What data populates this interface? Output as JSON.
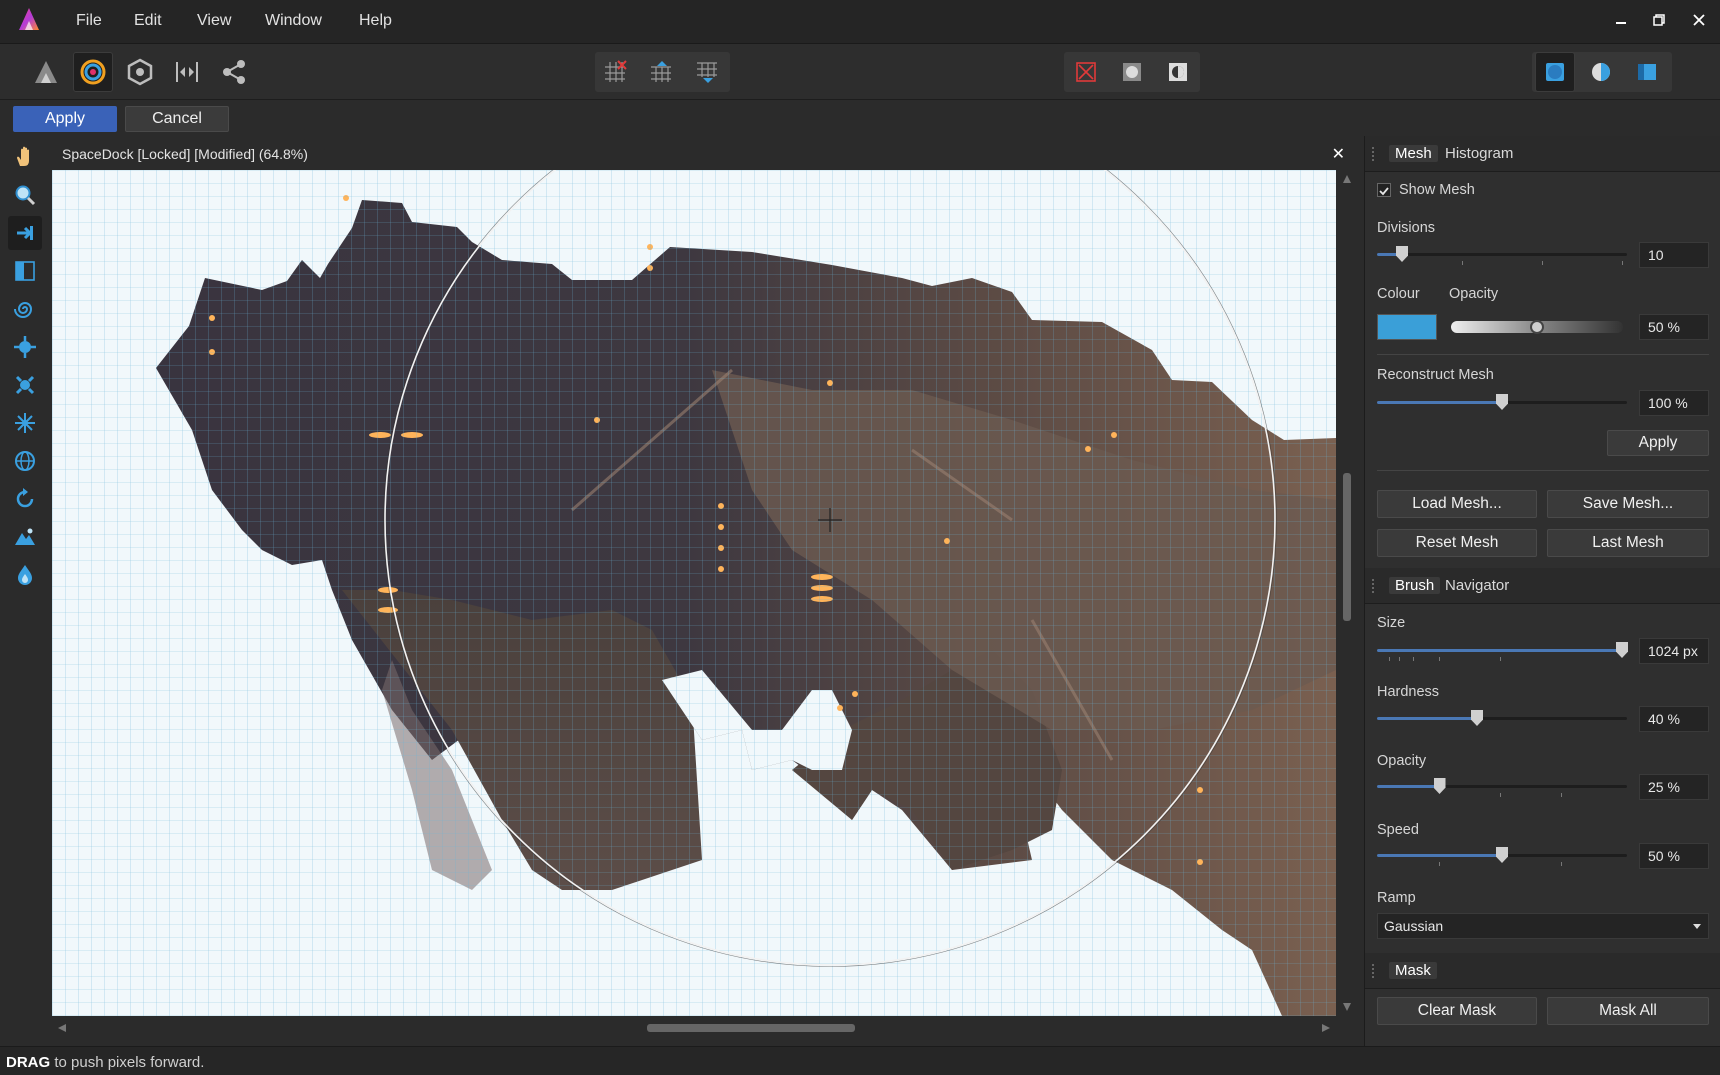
{
  "menu": {
    "items": [
      "File",
      "Edit",
      "View",
      "Window",
      "Help"
    ]
  },
  "icons": {
    "persona_photo": "triangle-persona-icon",
    "persona_liquify": "liquify-persona-icon",
    "persona_develop": "develop-persona-icon",
    "persona_tone": "tone-mapping-persona-icon",
    "persona_export": "export-persona-icon"
  },
  "context": {
    "apply": "Apply",
    "cancel": "Cancel"
  },
  "document": {
    "title": "SpaceDock [Locked] [Modified] (64.8%)"
  },
  "status": {
    "bold": "DRAG",
    "rest": " to push pixels forward."
  },
  "panel": {
    "mesh_tab": "Mesh",
    "histogram_tab": "Histogram",
    "show_mesh_label": "Show Mesh",
    "show_mesh_checked": true,
    "divisions_label": "Divisions",
    "divisions_value": "10",
    "divisions_level": 0.1,
    "colour_label": "Colour",
    "colour_value": "#3a9fd8",
    "opacity_label": "Opacity",
    "opacity_value": "50 %",
    "opacity_level": 0.5,
    "reconstruct_label": "Reconstruct Mesh",
    "reconstruct_value": "100 %",
    "reconstruct_level": 0.5,
    "apply_label": "Apply",
    "load_mesh": "Load Mesh...",
    "save_mesh": "Save Mesh...",
    "reset_mesh": "Reset Mesh",
    "last_mesh": "Last Mesh",
    "brush_tab": "Brush",
    "navigator_tab": "Navigator",
    "size_label": "Size",
    "size_value": "1024 px",
    "size_level": 0.98,
    "hardness_label": "Hardness",
    "hardness_value": "40 %",
    "hardness_level": 0.4,
    "brush_opacity_label": "Opacity",
    "brush_opacity_value": "25 %",
    "brush_opacity_level": 0.25,
    "speed_label": "Speed",
    "speed_value": "50 %",
    "speed_level": 0.5,
    "ramp_label": "Ramp",
    "ramp_value": "Gaussian",
    "mask_tab": "Mask",
    "clear_mask": "Clear Mask",
    "mask_all": "Mask All"
  },
  "colors": {
    "accent": "#3a62b8",
    "mesh": "#6bb4d6",
    "brush_ring": "#f2f2f2"
  }
}
